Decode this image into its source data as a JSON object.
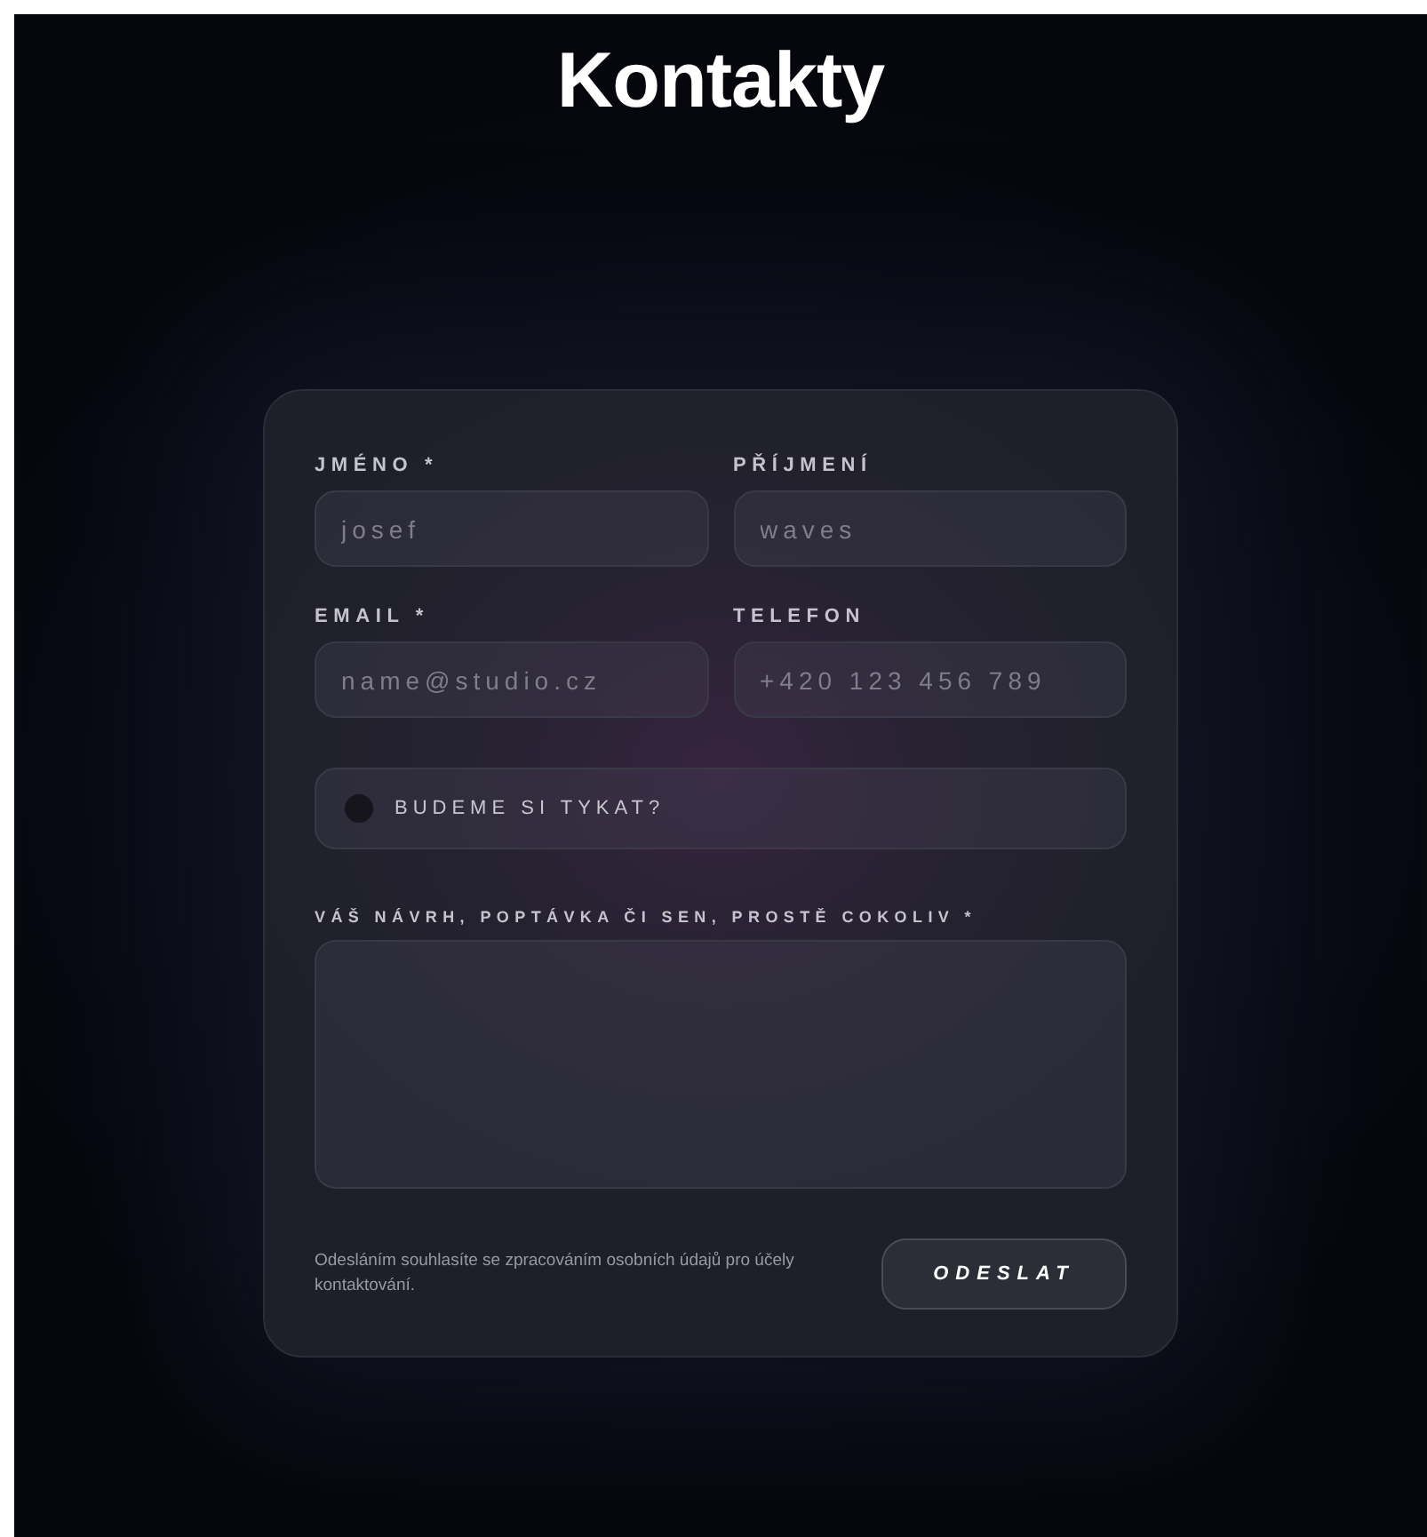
{
  "title": "Kontakty",
  "fields": [
    {
      "label": "JMÉNO *",
      "placeholder": "josef"
    },
    {
      "label": "PŘÍJMENÍ",
      "placeholder": "waves"
    },
    {
      "label": "EMAIL *",
      "placeholder": "name@studio.cz"
    },
    {
      "label": "TELEFON",
      "placeholder": "+420 123 456 789"
    }
  ],
  "toggle": {
    "label": "BUDEME SI TYKAT?",
    "checked": false
  },
  "message": {
    "label": "VÁŠ NÁVRH, POPTÁVKA ČI SEN, PROSTĚ COKOLIV *"
  },
  "consent": "Odesláním souhlasíte se zpracováním osobních údajů pro účely kontaktování.",
  "submit": "ODESLAT"
}
